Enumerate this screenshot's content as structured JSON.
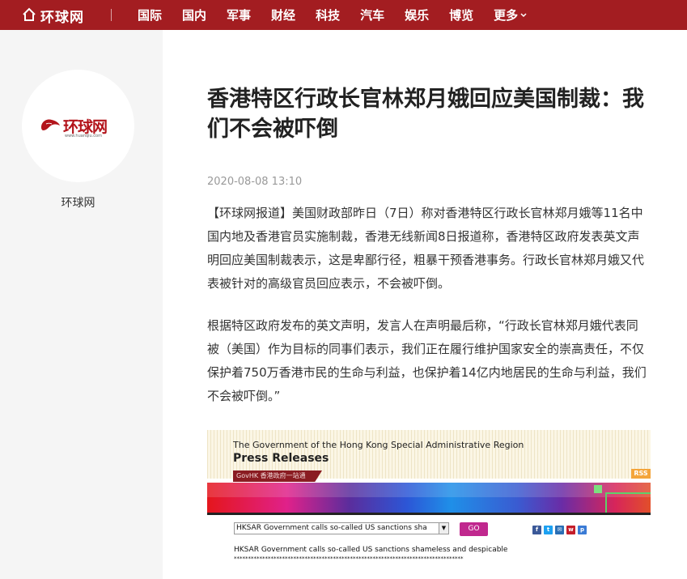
{
  "header": {
    "site_name": "环球网",
    "nav": [
      "国际",
      "国内",
      "军事",
      "财经",
      "科技",
      "汽车",
      "娱乐",
      "博览"
    ],
    "more_label": "更多"
  },
  "sidebar": {
    "avatar_logo_cn": "环球网",
    "avatar_logo_url": "www.huanqiu.com",
    "source_name": "环球网"
  },
  "article": {
    "title": "香港特区行政长官林郑月娥回应美国制裁：我们不会被吓倒",
    "date": "2020-08-08 13:10",
    "paragraphs": [
      "【环球网报道】美国财政部昨日（7日）称对香港特区行政长官林郑月娥等11名中国内地及香港官员实施制裁，香港无线新闻8日报道称，香港特区政府发表英文声明回应美国制裁表示，这是卑鄙行径，粗暴干预香港事务。行政长官林郑月娥又代表被针对的高级官员回应表示，不会被吓倒。",
      "根据特区政府发布的英文声明，发言人在声明最后称，“行政长官林郑月娥代表同被（美国）作为目标的同事们表示，我们正在履行维护国家安全的崇高责任，不仅保护着750万香港市民的生命与利益，也保护着14亿内地居民的生命与利益，我们不会被吓倒。”"
    ]
  },
  "embedded_image": {
    "gov_title": "The Government of the Hong Kong Special Administrative Region",
    "section": "Press Releases",
    "govhk_label": "GovHK 香港政府一站通",
    "rss_label": "RSS",
    "select_value": "HKSAR Government calls so-called US sanctions sha",
    "go_label": "GO",
    "release_title": "HKSAR Government calls so-called US sanctions shameless and despicable",
    "separator": "*********************************************************************************"
  },
  "colors": {
    "header_bg": "#a31d21",
    "sidebar_bg": "#f5f5f5",
    "brand_red": "#b3141b"
  }
}
